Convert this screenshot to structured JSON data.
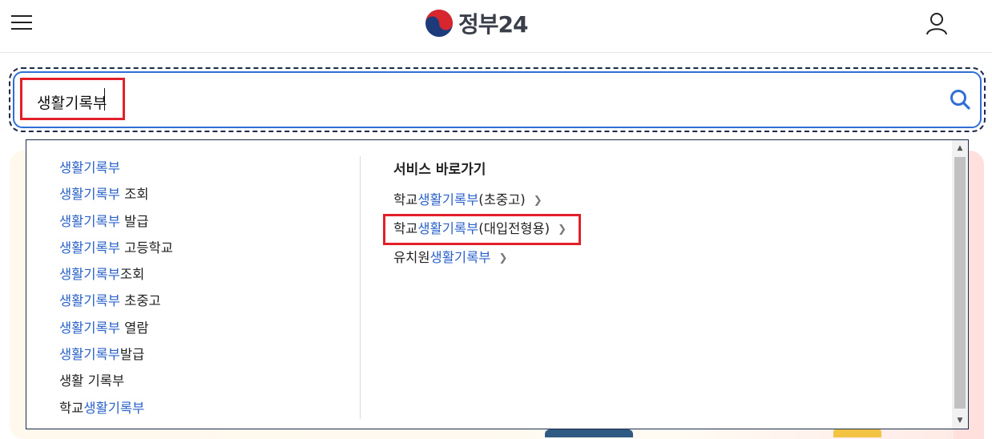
{
  "header": {
    "logo_text": "정부24",
    "menu_icon": "hamburger-menu-icon",
    "user_icon": "user-icon"
  },
  "search": {
    "value": "생활기록부",
    "icon": "search-icon"
  },
  "suggestions": [
    {
      "keyword": "생활기록부",
      "rest": ""
    },
    {
      "keyword": "생활기록부",
      "rest": " 조회"
    },
    {
      "keyword": "생활기록부",
      "rest": " 발급"
    },
    {
      "keyword": "생활기록부",
      "rest": " 고등학교"
    },
    {
      "keyword": "생활기록부",
      "rest": "조회"
    },
    {
      "keyword": "생활기록부",
      "rest": " 초중고"
    },
    {
      "keyword": "생활기록부",
      "rest": " 열람"
    },
    {
      "keyword": "생활기록부",
      "rest": "발급"
    },
    {
      "keyword": "",
      "rest": "생활 기록부"
    },
    {
      "prefix": "학교",
      "keyword": "생활기록부",
      "rest": ""
    }
  ],
  "services": {
    "title": "서비스 바로가기",
    "items": [
      {
        "prefix": "학교",
        "keyword": "생활기록부",
        "rest": "(초중고)"
      },
      {
        "prefix": "학교",
        "keyword": "생활기록부",
        "rest": "(대입전형용)"
      },
      {
        "prefix": "유치원",
        "keyword": "생활기록부",
        "rest": ""
      }
    ]
  },
  "colors": {
    "keyword": "#2a62c9",
    "highlight": "#e2202a",
    "focus": "#2f6fd6"
  }
}
